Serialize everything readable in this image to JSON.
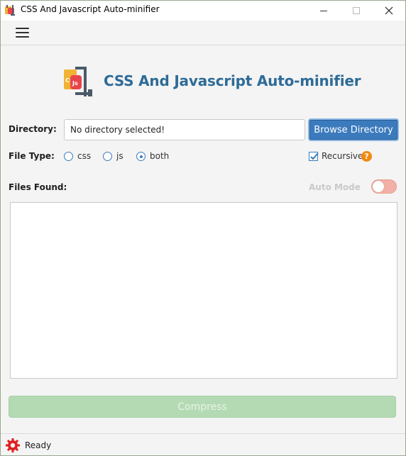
{
  "window": {
    "title": "CSS And Javascript Auto-minifier"
  },
  "header": {
    "title": "CSS And Javascript Auto-minifier",
    "logo_text": "CSS",
    "logo_badge": "Js"
  },
  "directory": {
    "label": "Directory:",
    "value": "No directory selected!",
    "browse_label": "Browse Directory"
  },
  "file_type": {
    "label": "File Type:",
    "options": [
      "css",
      "js",
      "both"
    ],
    "selected": "both"
  },
  "recursive": {
    "label": "Recursive",
    "checked": true,
    "help": "?"
  },
  "files": {
    "label": "Files Found:",
    "items": []
  },
  "auto_mode": {
    "label": "Auto Mode",
    "enabled": false
  },
  "compress": {
    "label": "Compress",
    "disabled": true
  },
  "status": {
    "text": "Ready"
  },
  "colors": {
    "accent": "#3b7bbd",
    "title": "#2e6b97",
    "compress_disabled": "#b4dab3",
    "toggle_off": "#f3b0a6",
    "help": "#f28a10"
  }
}
